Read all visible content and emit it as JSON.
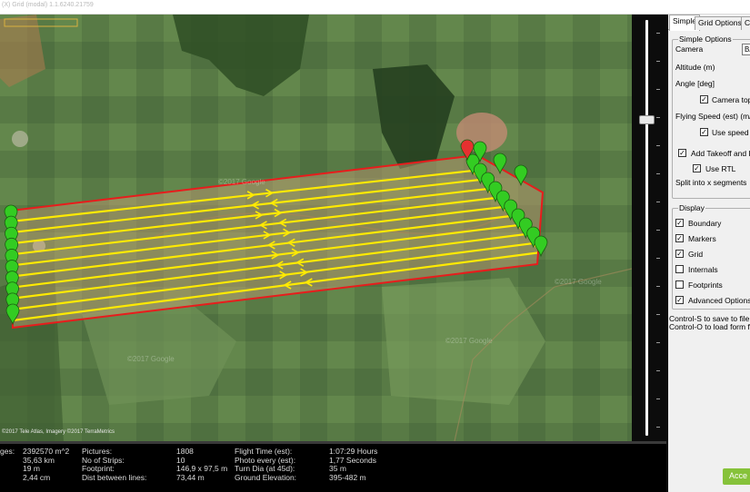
{
  "window": {
    "title": "(X) Grid (modal) 1.1.6240.21759"
  },
  "map": {
    "attribution": "©2017 Tele Atlas, Imagery ©2017 TerraMetrics",
    "watermarks": [
      "©2017 Google",
      "©2017 Google",
      "©2017 Google",
      "©2017 Google"
    ],
    "colors": {
      "boundary": "#e81c1c",
      "flight_path": "#ffea00",
      "marker": "#33cc22",
      "home_marker": "#e63030"
    },
    "strips": 10
  },
  "stats": {
    "col1": {
      "labels": [
        "",
        "",
        "ges:",
        ""
      ],
      "values": [
        "2392570 m^2",
        "35,63 km",
        "19 m",
        "2,44 cm"
      ]
    },
    "col2": {
      "labels": [
        "Pictures:",
        "No of Strips:",
        "Footprint:",
        "Dist between lines:"
      ],
      "values": [
        "1808",
        "10",
        "146,9 x 97,5 m",
        "73,44 m"
      ]
    },
    "col3": {
      "labels": [
        "Flight Time (est):",
        "Photo every (est):",
        "Turn Dia (at 45d):",
        "Ground Elevation:"
      ],
      "values": [
        "1:07:29 Hours",
        "1,77 Seconds",
        "35 m",
        "395-482 m"
      ]
    }
  },
  "tabs": [
    "Simple",
    "Grid Options",
    "Ca"
  ],
  "simple_options": {
    "group_title": "Simple Options",
    "camera_label": "Camera",
    "camera_value": "BA",
    "altitude_label": "Altitude (m)",
    "angle_label": "Angle [deg]",
    "camera_top_label": "Camera top",
    "flying_speed_label": "Flying Speed (est) (m/s)",
    "use_speed_label": "Use speed f",
    "takeoff_label": "Add Takeoff and L",
    "use_rtl_label": "Use RTL",
    "split_label": "Split into x segments"
  },
  "display": {
    "group_title": "Display",
    "items": [
      {
        "label": "Boundary",
        "checked": true
      },
      {
        "label": "Markers",
        "checked": true
      },
      {
        "label": "Grid",
        "checked": true
      },
      {
        "label": "Internals",
        "checked": false
      },
      {
        "label": "Footprints",
        "checked": false
      },
      {
        "label": "Advanced Options",
        "checked": true
      }
    ]
  },
  "help": {
    "save": "Control-S to save to file",
    "load": "Control-O to load form file"
  },
  "accept_label": "Acce",
  "zoom": {
    "level_fraction": 0.77
  }
}
